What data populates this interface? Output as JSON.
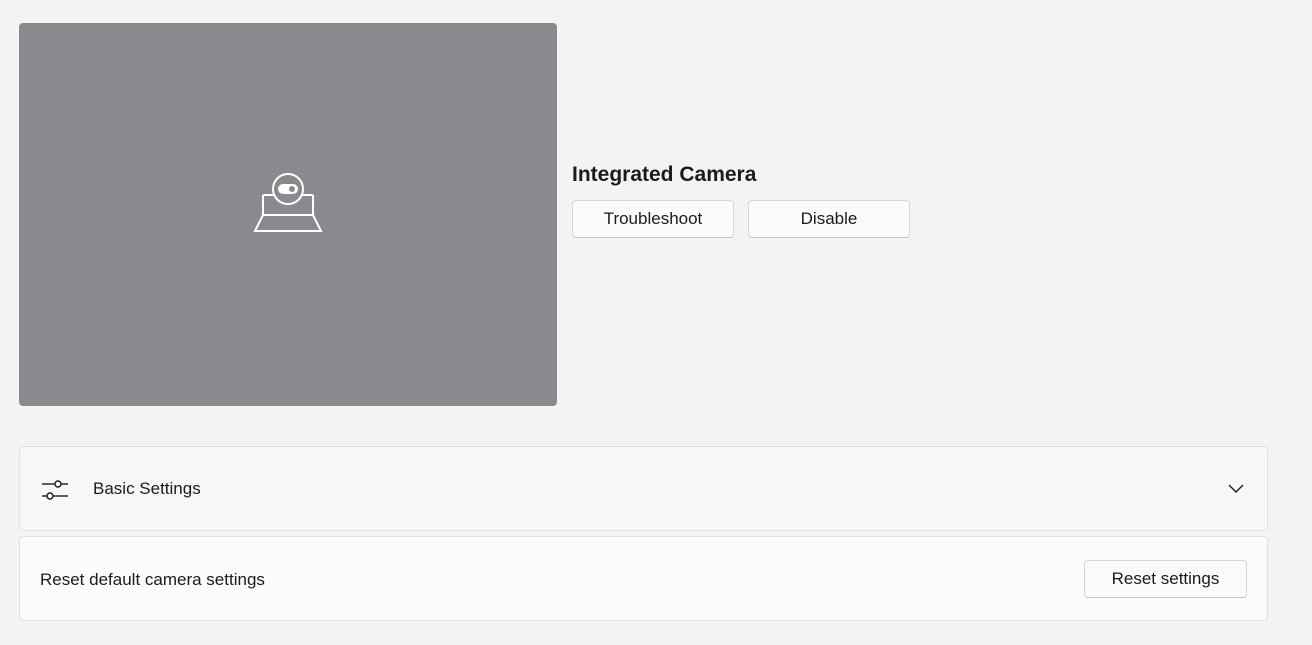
{
  "preview": {
    "icon": "camera-off-icon"
  },
  "camera": {
    "name": "Integrated Camera",
    "troubleshoot_label": "Troubleshoot",
    "disable_label": "Disable"
  },
  "basic_settings": {
    "icon": "sliders-icon",
    "label": "Basic Settings",
    "expand_icon": "chevron-down-icon"
  },
  "reset": {
    "label": "Reset default camera settings",
    "button_label": "Reset settings"
  },
  "colors": {
    "background": "#f3f3f3",
    "preview_background": "#8b898e",
    "card_background": "#fbfbfb",
    "text": "#1b1b1b"
  }
}
